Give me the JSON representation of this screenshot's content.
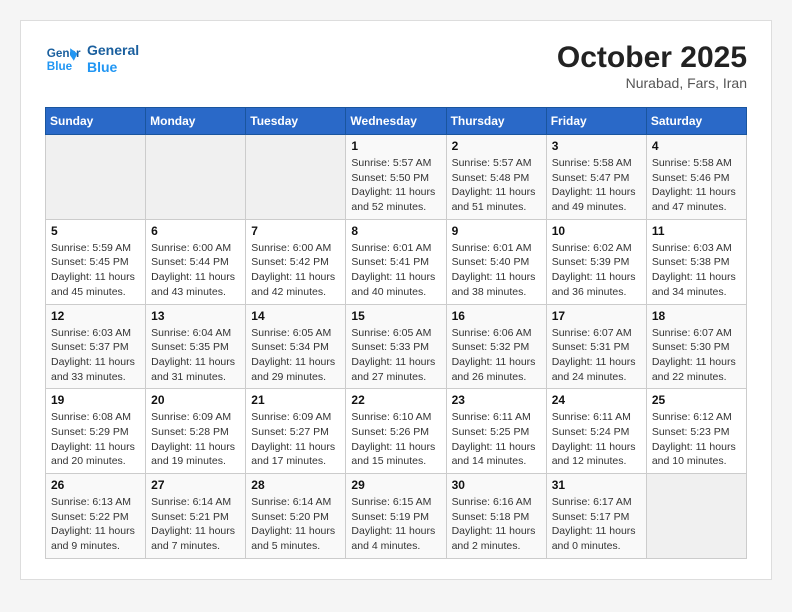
{
  "logo": {
    "line1": "General",
    "line2": "Blue"
  },
  "title": "October 2025",
  "location": "Nurabad, Fars, Iran",
  "weekdays": [
    "Sunday",
    "Monday",
    "Tuesday",
    "Wednesday",
    "Thursday",
    "Friday",
    "Saturday"
  ],
  "weeks": [
    [
      {
        "day": "",
        "info": ""
      },
      {
        "day": "",
        "info": ""
      },
      {
        "day": "",
        "info": ""
      },
      {
        "day": "1",
        "info": "Sunrise: 5:57 AM\nSunset: 5:50 PM\nDaylight: 11 hours and 52 minutes."
      },
      {
        "day": "2",
        "info": "Sunrise: 5:57 AM\nSunset: 5:48 PM\nDaylight: 11 hours and 51 minutes."
      },
      {
        "day": "3",
        "info": "Sunrise: 5:58 AM\nSunset: 5:47 PM\nDaylight: 11 hours and 49 minutes."
      },
      {
        "day": "4",
        "info": "Sunrise: 5:58 AM\nSunset: 5:46 PM\nDaylight: 11 hours and 47 minutes."
      }
    ],
    [
      {
        "day": "5",
        "info": "Sunrise: 5:59 AM\nSunset: 5:45 PM\nDaylight: 11 hours and 45 minutes."
      },
      {
        "day": "6",
        "info": "Sunrise: 6:00 AM\nSunset: 5:44 PM\nDaylight: 11 hours and 43 minutes."
      },
      {
        "day": "7",
        "info": "Sunrise: 6:00 AM\nSunset: 5:42 PM\nDaylight: 11 hours and 42 minutes."
      },
      {
        "day": "8",
        "info": "Sunrise: 6:01 AM\nSunset: 5:41 PM\nDaylight: 11 hours and 40 minutes."
      },
      {
        "day": "9",
        "info": "Sunrise: 6:01 AM\nSunset: 5:40 PM\nDaylight: 11 hours and 38 minutes."
      },
      {
        "day": "10",
        "info": "Sunrise: 6:02 AM\nSunset: 5:39 PM\nDaylight: 11 hours and 36 minutes."
      },
      {
        "day": "11",
        "info": "Sunrise: 6:03 AM\nSunset: 5:38 PM\nDaylight: 11 hours and 34 minutes."
      }
    ],
    [
      {
        "day": "12",
        "info": "Sunrise: 6:03 AM\nSunset: 5:37 PM\nDaylight: 11 hours and 33 minutes."
      },
      {
        "day": "13",
        "info": "Sunrise: 6:04 AM\nSunset: 5:35 PM\nDaylight: 11 hours and 31 minutes."
      },
      {
        "day": "14",
        "info": "Sunrise: 6:05 AM\nSunset: 5:34 PM\nDaylight: 11 hours and 29 minutes."
      },
      {
        "day": "15",
        "info": "Sunrise: 6:05 AM\nSunset: 5:33 PM\nDaylight: 11 hours and 27 minutes."
      },
      {
        "day": "16",
        "info": "Sunrise: 6:06 AM\nSunset: 5:32 PM\nDaylight: 11 hours and 26 minutes."
      },
      {
        "day": "17",
        "info": "Sunrise: 6:07 AM\nSunset: 5:31 PM\nDaylight: 11 hours and 24 minutes."
      },
      {
        "day": "18",
        "info": "Sunrise: 6:07 AM\nSunset: 5:30 PM\nDaylight: 11 hours and 22 minutes."
      }
    ],
    [
      {
        "day": "19",
        "info": "Sunrise: 6:08 AM\nSunset: 5:29 PM\nDaylight: 11 hours and 20 minutes."
      },
      {
        "day": "20",
        "info": "Sunrise: 6:09 AM\nSunset: 5:28 PM\nDaylight: 11 hours and 19 minutes."
      },
      {
        "day": "21",
        "info": "Sunrise: 6:09 AM\nSunset: 5:27 PM\nDaylight: 11 hours and 17 minutes."
      },
      {
        "day": "22",
        "info": "Sunrise: 6:10 AM\nSunset: 5:26 PM\nDaylight: 11 hours and 15 minutes."
      },
      {
        "day": "23",
        "info": "Sunrise: 6:11 AM\nSunset: 5:25 PM\nDaylight: 11 hours and 14 minutes."
      },
      {
        "day": "24",
        "info": "Sunrise: 6:11 AM\nSunset: 5:24 PM\nDaylight: 11 hours and 12 minutes."
      },
      {
        "day": "25",
        "info": "Sunrise: 6:12 AM\nSunset: 5:23 PM\nDaylight: 11 hours and 10 minutes."
      }
    ],
    [
      {
        "day": "26",
        "info": "Sunrise: 6:13 AM\nSunset: 5:22 PM\nDaylight: 11 hours and 9 minutes."
      },
      {
        "day": "27",
        "info": "Sunrise: 6:14 AM\nSunset: 5:21 PM\nDaylight: 11 hours and 7 minutes."
      },
      {
        "day": "28",
        "info": "Sunrise: 6:14 AM\nSunset: 5:20 PM\nDaylight: 11 hours and 5 minutes."
      },
      {
        "day": "29",
        "info": "Sunrise: 6:15 AM\nSunset: 5:19 PM\nDaylight: 11 hours and 4 minutes."
      },
      {
        "day": "30",
        "info": "Sunrise: 6:16 AM\nSunset: 5:18 PM\nDaylight: 11 hours and 2 minutes."
      },
      {
        "day": "31",
        "info": "Sunrise: 6:17 AM\nSunset: 5:17 PM\nDaylight: 11 hours and 0 minutes."
      },
      {
        "day": "",
        "info": ""
      }
    ]
  ]
}
